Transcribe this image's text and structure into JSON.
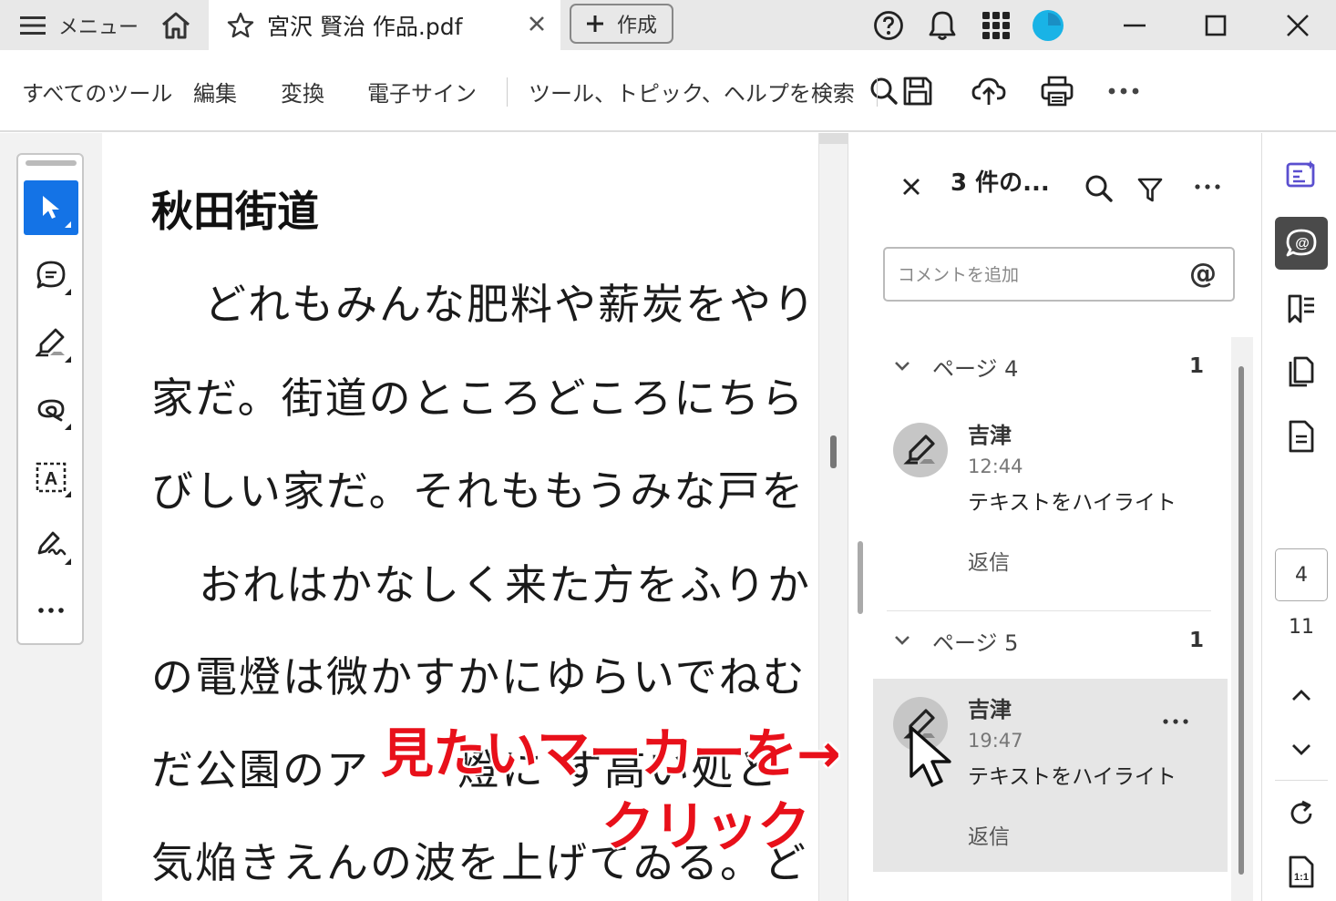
{
  "titlebar": {
    "menu_label": "メニュー",
    "tab_name": "宮沢 賢治 作品.pdf",
    "create_label": "作成"
  },
  "toolbar": {
    "all_tools": "すべてのツール",
    "edit": "編集",
    "convert": "変換",
    "esign": "電子サイン",
    "search_label": "ツール、トピック、ヘルプを検索"
  },
  "document": {
    "title": "秋田街道",
    "lines": [
      "どれもみんな肥料や薪炭をやり",
      "家だ。街道のところどころにちら",
      "びしい家だ。それももうみな戸を",
      "おれはかなしく来た方をふりか",
      "の電燈は微かすかにゆらいでねむ",
      "だ公園のア　　燈に す高い処と",
      "気焔きえんの波を上げてゐる。ど"
    ]
  },
  "comments_panel": {
    "title": "3 件の...",
    "input_placeholder": "コメントを追加",
    "at_symbol": "@",
    "groups": [
      {
        "label": "ページ 4",
        "count": "1",
        "comment": {
          "author": "吉津",
          "time": "12:44",
          "action": "テキストをハイライト",
          "reply": "返信"
        }
      },
      {
        "label": "ページ 5",
        "count": "1",
        "comment": {
          "author": "吉津",
          "time": "19:47",
          "action": "テキストをハイライト",
          "reply": "返信"
        }
      }
    ]
  },
  "right_rail": {
    "current_page": "4",
    "total_pages": "11"
  },
  "annotation": {
    "line1": "見たいマーカーを→",
    "line2": "クリック"
  },
  "colors": {
    "accent": "#1473e6",
    "annotation_red": "#e8101a",
    "avatar_blue": "#19b3e6"
  }
}
